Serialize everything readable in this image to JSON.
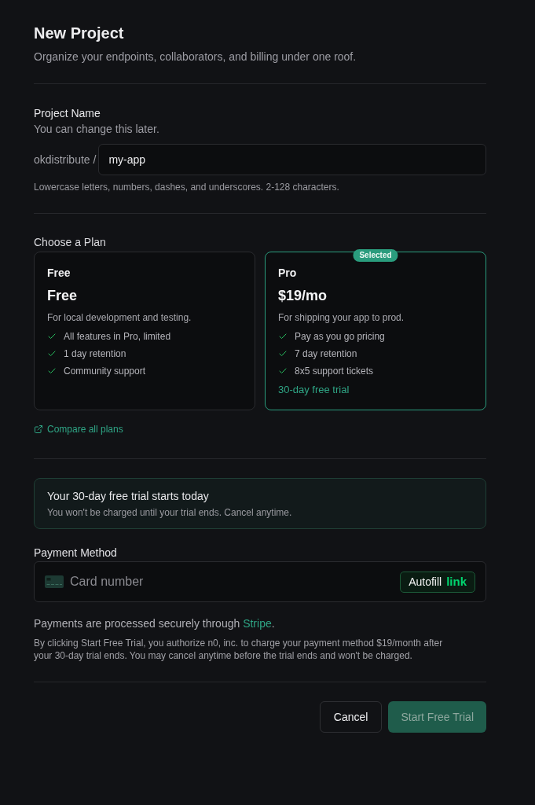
{
  "header": {
    "title": "New Project",
    "subtitle": "Organize your endpoints, collaborators, and billing under one roof."
  },
  "project_name": {
    "label": "Project Name",
    "help": "You can change this later.",
    "prefix": "okdistribute /",
    "value": "my-app",
    "hint": "Lowercase letters, numbers, dashes, and underscores. 2-128 characters."
  },
  "plans": {
    "label": "Choose a Plan",
    "options": [
      {
        "name": "Free",
        "price": "Free",
        "description": "For local development and testing.",
        "features": [
          "All features in Pro, limited",
          "1 day retention",
          "Community support"
        ],
        "selected": false
      },
      {
        "name": "Pro",
        "price": "$19/mo",
        "description": "For shipping your app to prod.",
        "features": [
          "Pay as you go pricing",
          "7 day retention",
          "8x5 support tickets"
        ],
        "trial": "30-day free trial",
        "badge": "Selected",
        "selected": true
      }
    ],
    "compare_link": "Compare all plans"
  },
  "trial_banner": {
    "title": "Your 30-day free trial starts today",
    "text": "You won't be charged until your trial ends. Cancel anytime."
  },
  "payment": {
    "label": "Payment Method",
    "card_placeholder": "Card number",
    "autofill": {
      "label": "Autofill",
      "brand": "link"
    },
    "secure_note": {
      "before": "Payments are processed securely through ",
      "link": "Stripe",
      "after": "."
    },
    "legal": "By clicking Start Free Trial, you authorize n0, inc. to charge your payment method $19/month after your 30-day trial ends. You may cancel anytime before the trial ends and won't be charged."
  },
  "actions": [
    {
      "label": "Cancel",
      "kind": "secondary",
      "disabled": false
    },
    {
      "label": "Start Free Trial",
      "kind": "primary",
      "disabled": true
    }
  ]
}
